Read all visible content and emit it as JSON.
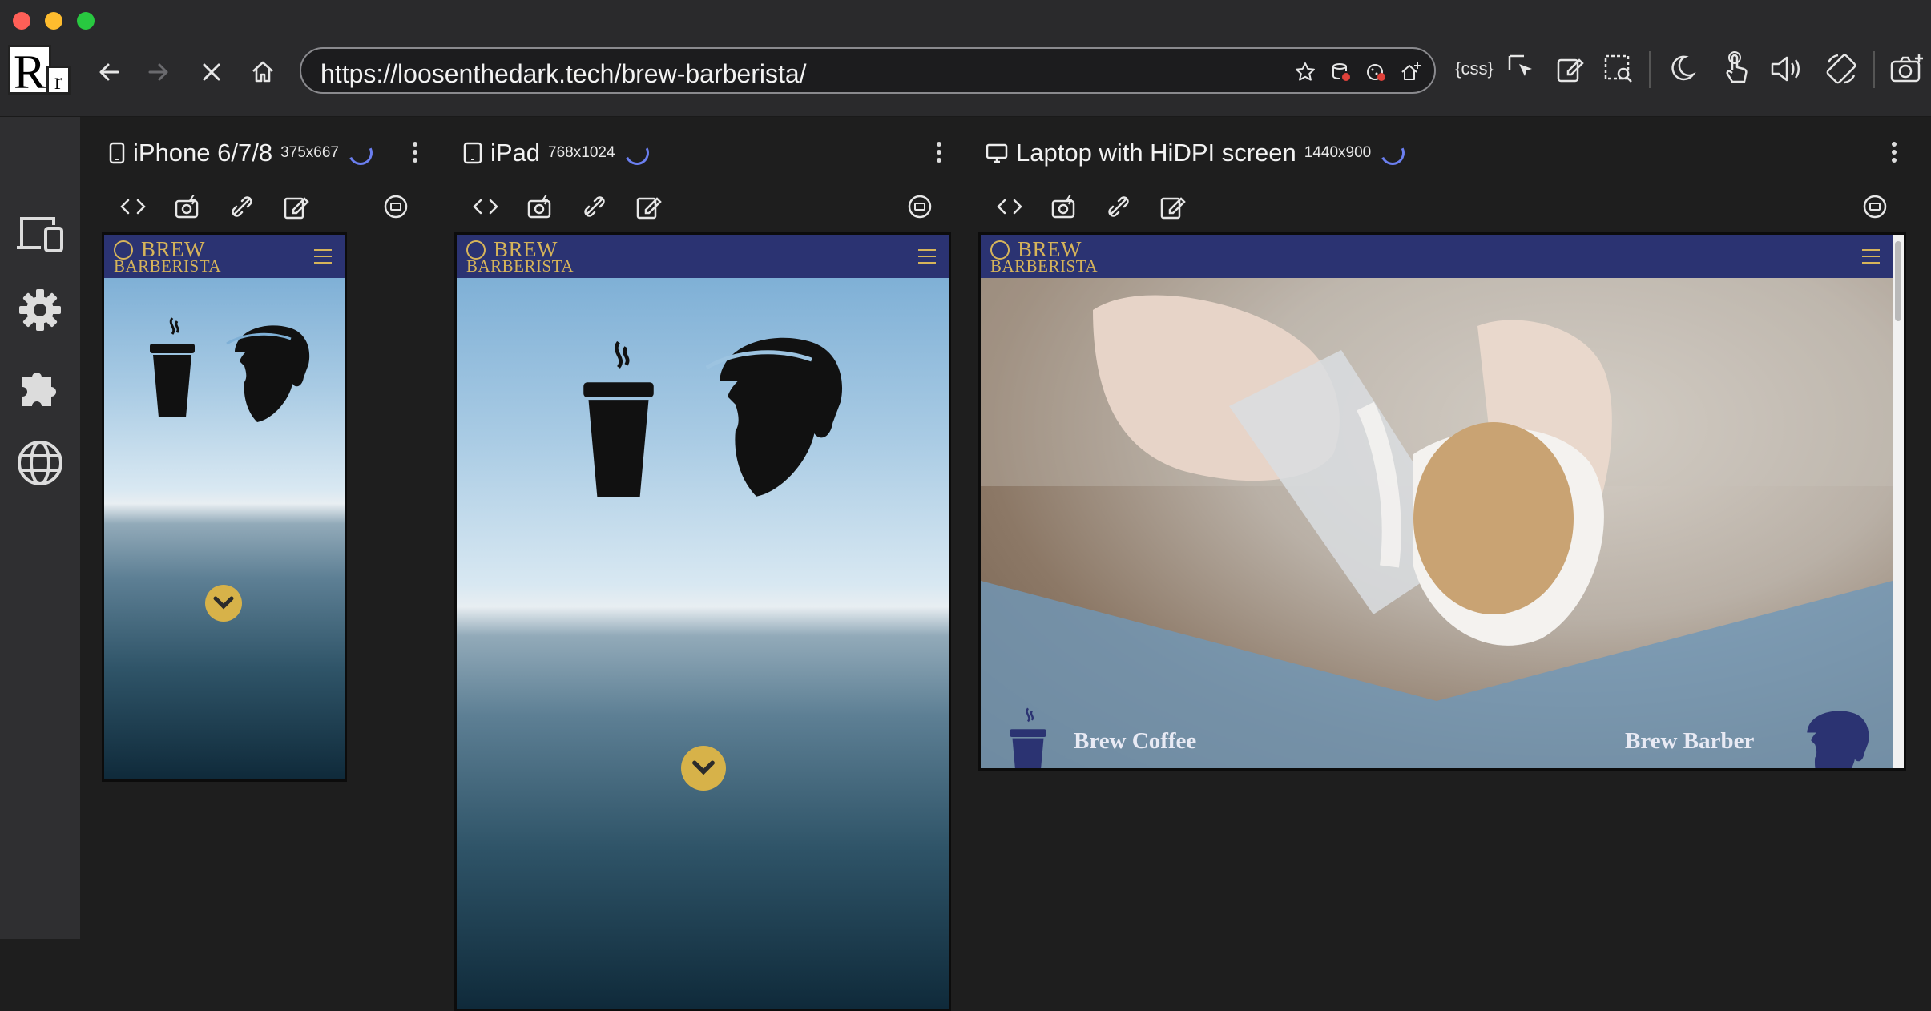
{
  "browser": {
    "url": "https://loosenthedark.tech/brew-barberista/",
    "logo_text_big": "R",
    "logo_text_small": "r",
    "css_label": "{css}"
  },
  "devices": [
    {
      "name": "iPhone 6/7/8",
      "size": "375x667"
    },
    {
      "name": "iPad",
      "size": "768x1024"
    },
    {
      "name": "Laptop with HiDPI screen",
      "size": "1440x900"
    }
  ],
  "site": {
    "brand_top": "BREW",
    "brand_bottom": "BARBERISTA",
    "cta_left": "Brew Coffee",
    "cta_right": "Brew Barber"
  },
  "colors": {
    "site_header": "#2b3372",
    "brand_gold": "#d6b45a",
    "scroll_button": "#d7b249",
    "spinner": "#6b7ff0"
  }
}
